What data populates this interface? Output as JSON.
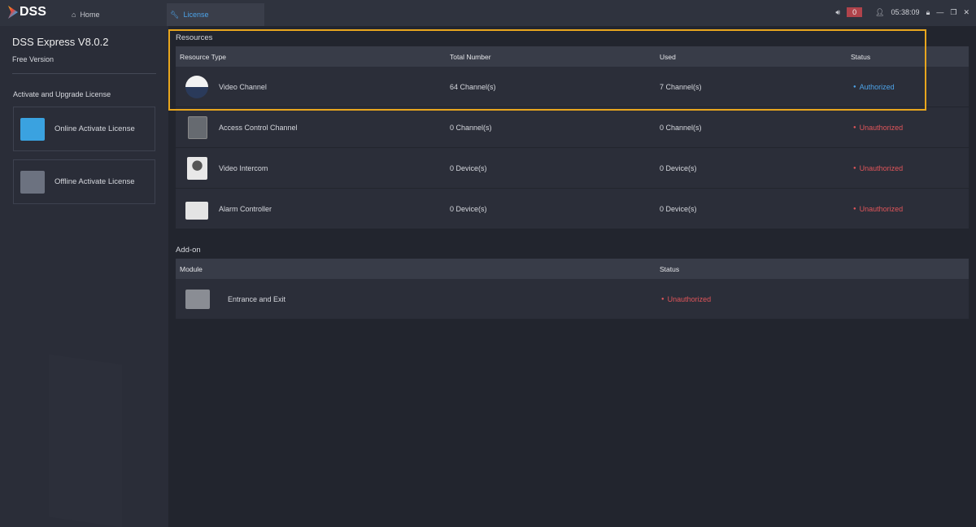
{
  "topbar": {
    "logo": "DSS",
    "tabs": [
      {
        "label": "Home",
        "icon": "home-icon"
      },
      {
        "label": "License",
        "icon": "wrench-icon"
      }
    ],
    "alarm_count": "0",
    "time": "05:38:09"
  },
  "sidebar": {
    "title": "DSS Express V8.0.2",
    "edition": "Free Version",
    "section": "Activate and Upgrade License",
    "buttons": [
      {
        "label": "Online Activate License"
      },
      {
        "label": "Offline Activate License"
      }
    ]
  },
  "resources": {
    "title": "Resources",
    "columns": [
      "Resource Type",
      "Total Number",
      "Used",
      "Status"
    ],
    "rows": [
      {
        "type": "Video Channel",
        "total": "64 Channel(s)",
        "used": "7 Channel(s)",
        "status": "Authorized",
        "icon": "camera-icon"
      },
      {
        "type": "Access Control Channel",
        "total": "0 Channel(s)",
        "used": "0 Channel(s)",
        "status": "Unauthorized",
        "icon": "door-icon"
      },
      {
        "type": "Video Intercom",
        "total": "0 Device(s)",
        "used": "0 Device(s)",
        "status": "Unauthorized",
        "icon": "intercom-icon"
      },
      {
        "type": "Alarm Controller",
        "total": "0 Device(s)",
        "used": "0 Device(s)",
        "status": "Unauthorized",
        "icon": "alarm-controller-icon"
      }
    ]
  },
  "addon": {
    "title": "Add-on",
    "columns": [
      "Module",
      "Status"
    ],
    "rows": [
      {
        "module": "Entrance and Exit",
        "status": "Unauthorized",
        "icon": "barrier-icon"
      }
    ]
  },
  "colors": {
    "accent": "#4da3e8",
    "error": "#e0555a",
    "highlight": "#e8a61e"
  }
}
